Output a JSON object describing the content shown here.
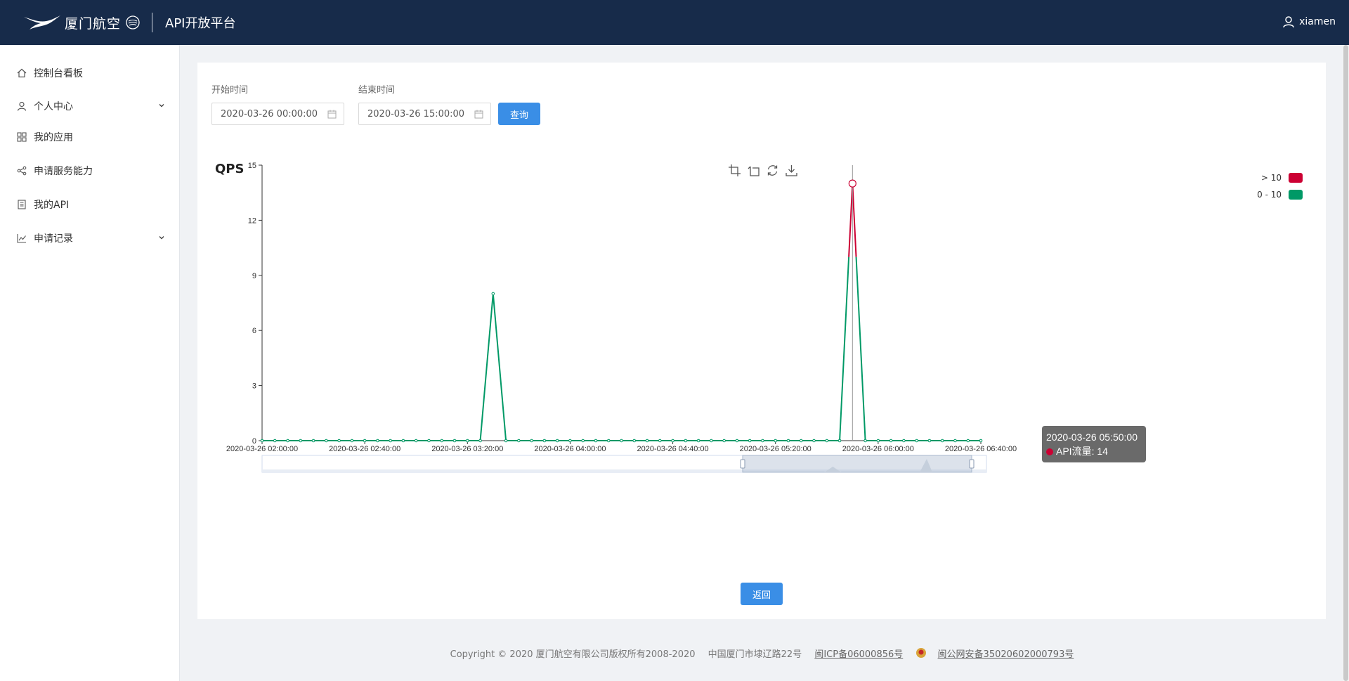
{
  "header": {
    "logo_text": "厦门航空",
    "platform_name": "API开放平台",
    "username": "xiamen"
  },
  "sidebar": {
    "items": [
      {
        "label": "控制台看板",
        "icon": "home-icon",
        "has_arrow": false
      },
      {
        "label": "个人中心",
        "icon": "user-icon",
        "has_arrow": true
      },
      {
        "label": "我的应用",
        "icon": "grid-icon",
        "has_arrow": false
      },
      {
        "label": "申请服务能力",
        "icon": "share-icon",
        "has_arrow": false
      },
      {
        "label": "我的API",
        "icon": "book-icon",
        "has_arrow": false
      },
      {
        "label": "申请记录",
        "icon": "chart-line-icon",
        "has_arrow": true
      }
    ]
  },
  "filters": {
    "start_label": "开始时间",
    "start_value": "2020-03-26 00:00:00",
    "end_label": "结束时间",
    "end_value": "2020-03-26 15:00:00",
    "query_label": "查询"
  },
  "chart_title": "QPS",
  "toolbox": [
    "zoom-icon",
    "zoom-reset-icon",
    "restore-icon",
    "download-icon"
  ],
  "chart_data": {
    "type": "line",
    "title": "QPS",
    "ylim": [
      0,
      15
    ],
    "yticks": [
      "0",
      "3",
      "6",
      "9",
      "12",
      "15"
    ],
    "xticks": [
      "2020-03-26 02:00:00",
      "2020-03-26 02:40:00",
      "2020-03-26 03:20:00",
      "2020-03-26 04:00:00",
      "2020-03-26 04:40:00",
      "2020-03-26 05:20:00",
      "2020-03-26 06:00:00",
      "2020-03-26 06:40:00"
    ],
    "x_start": "2020-03-26 02:00:00",
    "x_end": "2020-03-26 06:40:00",
    "step_minutes": 5,
    "peaks": [
      {
        "time": "2020-03-26 03:30:00",
        "value": 8
      },
      {
        "time": "2020-03-26 05:50:00",
        "value": 14
      }
    ],
    "visual_map": [
      {
        "label": "> 10",
        "color": "#cc0033"
      },
      {
        "label": "0 - 10",
        "color": "#009966"
      }
    ],
    "series": [
      {
        "name": "API流量"
      }
    ]
  },
  "tooltip": {
    "time": "2020-03-26 05:50:00",
    "label": "API流量: 14",
    "dot_color": "#cc0033"
  },
  "back_label": "返回",
  "footer": {
    "copyright": "Copyright © 2020 厦门航空有限公司版权所有2008-2020",
    "address": "中国厦门市埭辽路22号",
    "icp": "闽ICP备06000856号",
    "police": "闽公网安备35020602000793号"
  }
}
